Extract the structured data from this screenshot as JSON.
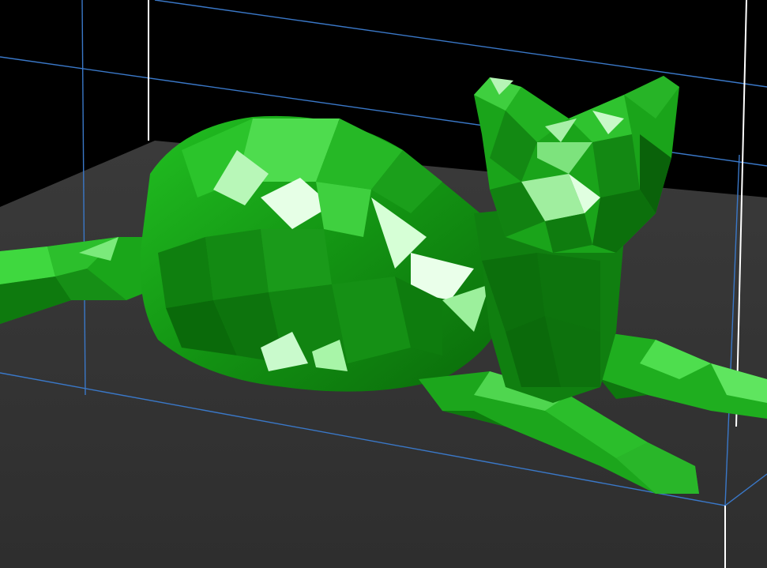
{
  "viewport": {
    "description_free": true,
    "colors": {
      "background": "#000000",
      "floor": "#353535",
      "box_edge_blue": "#3a78c8",
      "box_edge_white": "#ffffff",
      "model_dark": "#0a6b0a",
      "model_mid": "#1fa51f",
      "model_light": "#3fd93f",
      "model_highlight": "#d8ffd8"
    }
  }
}
